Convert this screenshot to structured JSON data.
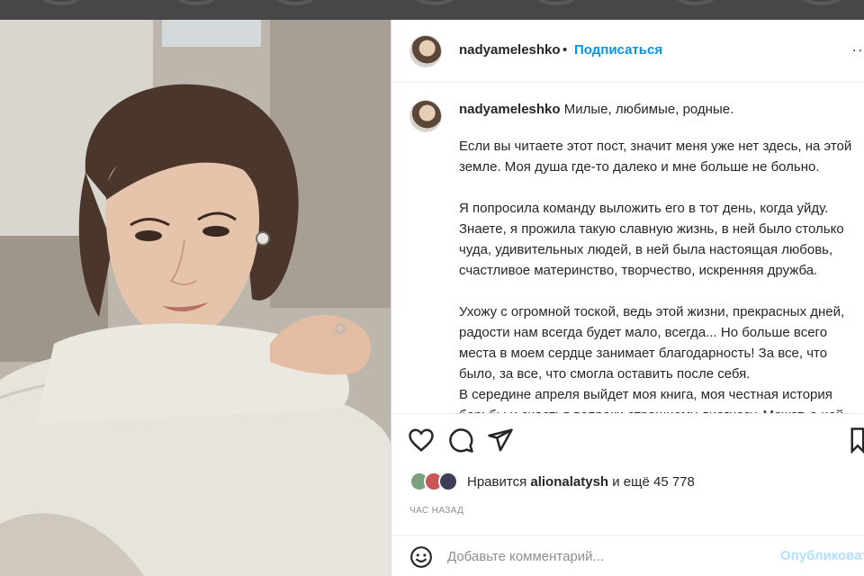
{
  "post": {
    "username": "nadyameleshko",
    "separator": "•",
    "follow_label": "Подписаться",
    "more_label": "..."
  },
  "caption": {
    "username": "nadyameleshko",
    "first_line": "Милые, любимые, родные.",
    "paragraphs": [
      [
        "Если вы читаете этот пост, значит меня уже нет здесь, на этой",
        "земле. Моя душа где-то далеко и мне больше не больно."
      ],
      [
        "Я попросила команду выложить его в тот день, когда уйду.",
        "Знаете, я прожила такую славную жизнь, в ней было столько",
        "чуда, удивительных людей, в ней была настоящая любовь,",
        "счастливое материнство, творчество, искренняя дружба."
      ],
      [
        "Ухожу с огромной тоской, ведь этой жизни, прекрасных дней,",
        "радости нам всегда будет мало, всегда... Но больше всего",
        "места в моем сердце занимает благодарность! За все, что",
        "было, за все, что смогла оставить после себя."
      ],
      [
        "В середине апреля выйдет моя книга, моя честная история",
        "борьбы и счастья вопреки страшному диагнозу. Может, о ней"
      ]
    ]
  },
  "likes": {
    "prefix": "Нравится",
    "user": "alionalatysh",
    "suffix": "и ещё 45 778"
  },
  "time_ago": "ЧАС НАЗАД",
  "comment": {
    "placeholder": "Добавьте комментарий...",
    "publish_label": "Опубликовать"
  },
  "icons": [
    "heart-icon",
    "comment-icon",
    "share-icon",
    "bookmark-icon",
    "emoji-icon"
  ],
  "colors": {
    "link": "#0095f6",
    "text": "#262626",
    "muted": "#8e8e8e",
    "publish_disabled": "#b2dffc"
  }
}
